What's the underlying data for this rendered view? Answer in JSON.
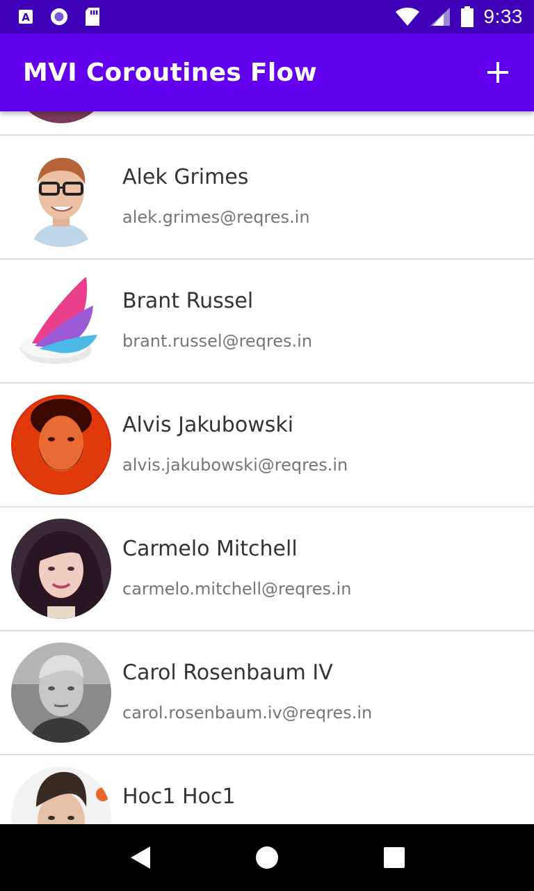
{
  "status_bar": {
    "time": "9:33",
    "left_icons": [
      "text-a-icon",
      "circle-dot-icon",
      "sd-card-icon"
    ],
    "right_icons": [
      "wifi-icon",
      "cell-signal-icon",
      "battery-icon"
    ]
  },
  "app_bar": {
    "title": "MVI Coroutines Flow",
    "action_icon": "add-icon"
  },
  "users": [
    {
      "name": "",
      "email": "",
      "avatar": "partial-avatar"
    },
    {
      "name": "Alek Grimes",
      "email": "alek.grimes@reqres.in",
      "avatar": "man-with-glasses"
    },
    {
      "name": "Brant Russel",
      "email": "brant.russel@reqres.in",
      "avatar": "wing-logo"
    },
    {
      "name": "Alvis Jakubowski",
      "email": "alvis.jakubowski@reqres.in",
      "avatar": "bearded-man-red"
    },
    {
      "name": "Carmelo Mitchell",
      "email": "carmelo.mitchell@reqres.in",
      "avatar": "woman-dark-hair"
    },
    {
      "name": "Carol Rosenbaum IV",
      "email": "carol.rosenbaum.iv@reqres.in",
      "avatar": "man-grayscale"
    },
    {
      "name": "Hoc1 Hoc1",
      "email": "",
      "avatar": "man-dark-hair"
    }
  ],
  "nav_bar": {
    "buttons": [
      "back-icon",
      "home-icon",
      "recents-icon"
    ]
  },
  "colors": {
    "status_bar": "#3f00b8",
    "app_bar": "#6200ee",
    "divider": "#dcdcdc",
    "name_text": "#333333",
    "email_text": "#757575"
  }
}
